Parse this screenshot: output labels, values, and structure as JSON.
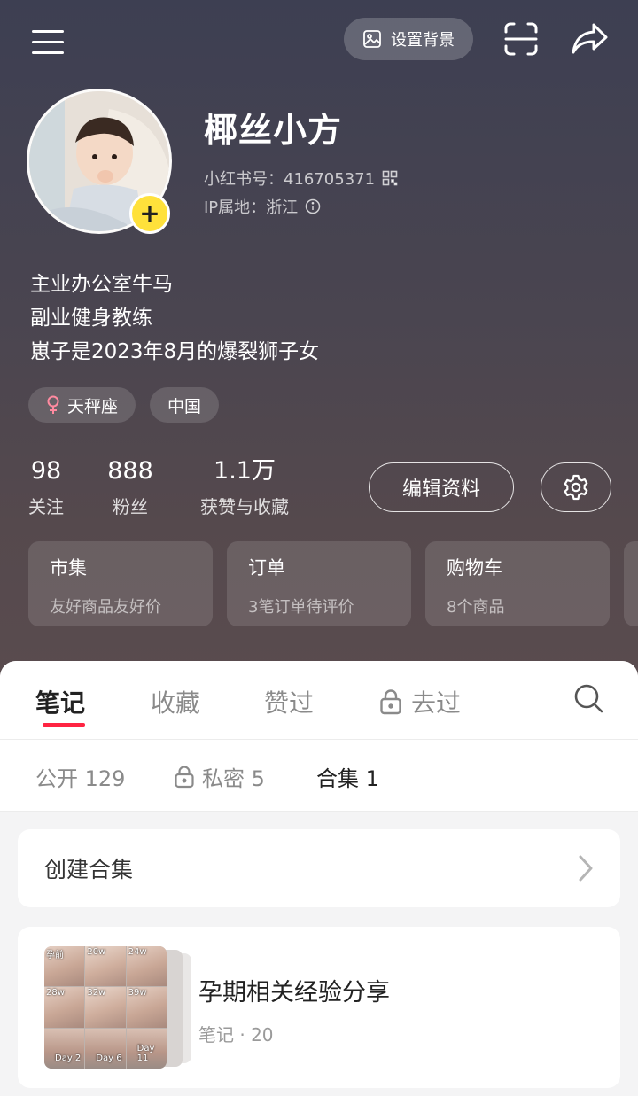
{
  "header": {
    "set_background_label": "设置背景",
    "icons": [
      "menu-icon",
      "image-icon",
      "scan-icon",
      "share-icon"
    ]
  },
  "profile": {
    "nickname": "椰丝小方",
    "id_label": "小红书号：416705371",
    "ip_label": "IP属地：浙江",
    "bio": [
      "主业办公室牛马",
      "副业健身教练",
      "崽子是2023年8月的爆裂狮子女"
    ],
    "tags": [
      {
        "icon": "female-icon",
        "label": "天秤座"
      },
      {
        "label": "中国"
      }
    ],
    "accent_add": "#ffe13b"
  },
  "stats": [
    {
      "value": "98",
      "label": "关注"
    },
    {
      "value": "888",
      "label": "粉丝"
    },
    {
      "value": "1.1万",
      "label": "获赞与收藏"
    }
  ],
  "actions": {
    "edit_label": "编辑资料"
  },
  "cards": [
    {
      "title": "市集",
      "subtitle": "友好商品友好价"
    },
    {
      "title": "订单",
      "subtitle": "3笔订单待评价"
    },
    {
      "title": "购物车",
      "subtitle": "8个商品"
    }
  ],
  "tabs": [
    {
      "label": "笔记",
      "active": true
    },
    {
      "label": "收藏"
    },
    {
      "label": "赞过"
    },
    {
      "label": "去过",
      "icon": "lock-icon"
    }
  ],
  "subtabs": [
    {
      "label": "公开 129"
    },
    {
      "label": "私密 5",
      "icon": "lock-icon"
    },
    {
      "label": "合集 1",
      "active": true
    }
  ],
  "create_collection_label": "创建合集",
  "collection": {
    "title": "孕期相关经验分享",
    "meta": "笔记 · 20",
    "thumb_labels": [
      "孕前",
      "20w",
      "24w",
      "28w",
      "32w",
      "39w",
      "Day 2",
      "Day 6",
      "Day 11"
    ]
  },
  "colors": {
    "tab_indicator": "#ff2442"
  }
}
